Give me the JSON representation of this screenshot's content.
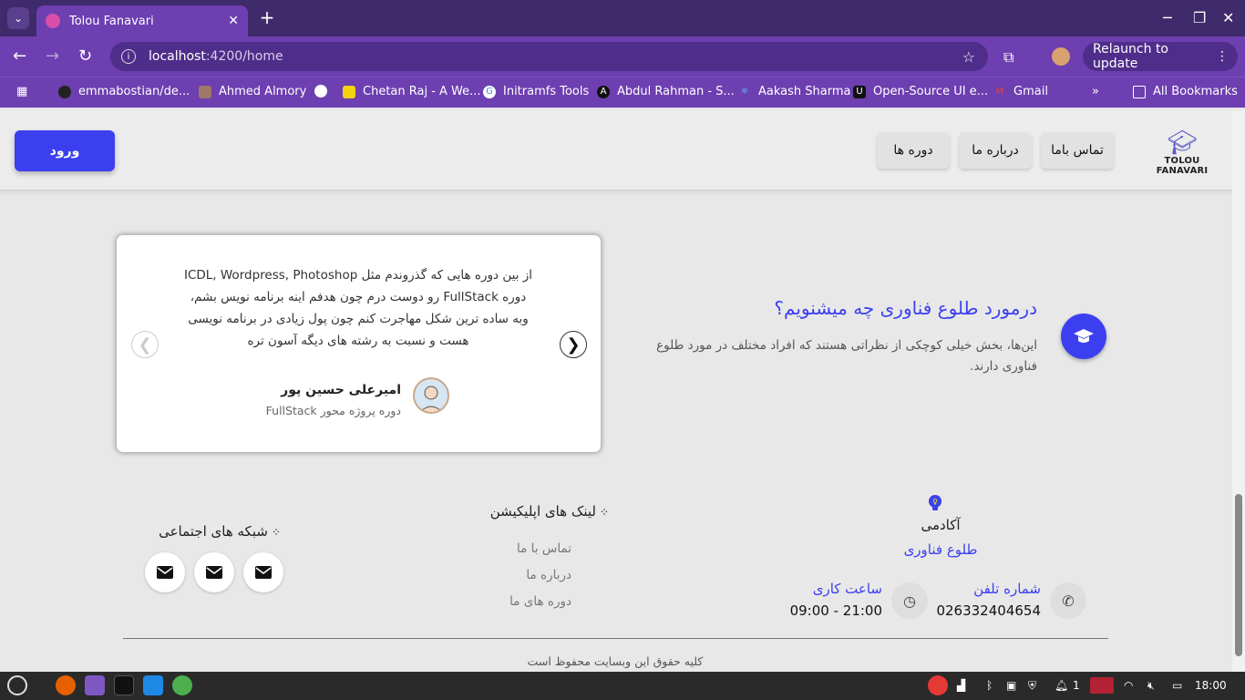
{
  "browser": {
    "tab_title": "Tolou Fanavari",
    "url_host": "localhost",
    "url_path": ":4200/home",
    "relaunch_label": "Relaunch to update",
    "bookmarks": [
      "emmabostian/de...",
      "Ahmed Almory",
      "",
      "Chetan Raj - A We...",
      "Initramfs Tools",
      "Abdul Rahman - S...",
      "Aakash Sharma",
      "Open-Source UI e...",
      "Gmail"
    ],
    "all_bookmarks": "All Bookmarks"
  },
  "header": {
    "login_label": "ورود",
    "nav": [
      "تماس باما",
      "درباره ما",
      "دوره ها"
    ],
    "logo_text": "TOLOU FANAVARI"
  },
  "testimonial": {
    "quote": "از بین دوره هایی که گذروندم مثل ICDL, Wordpress, Photoshop دوره FullStack رو دوست درم چون هدفم اینه برنامه نویس بشم، وبه ساده ترین شکل مهاجرت کنم چون پول زیادی در برنامه نویسی هست و نسبت به رشته های دیگه آسون تره",
    "name": "امیرعلی حسین پور",
    "course": "دوره پروژه محور FullStack",
    "next_arrow": "❯",
    "prev_arrow": "❮"
  },
  "about": {
    "title": "درمورد طلوع فناوری چه میشنویم؟",
    "text": "این‌ها، بخش خیلی کوچکی از نظراتی هستند که افراد مختلف در مورد طلوع فناوری دارند."
  },
  "footer": {
    "social_title": "شبکه های اجتماعی",
    "links_title": "لینک های اپلیکیشن",
    "links": [
      "تماس با ما",
      "درباره ما",
      "دوره های ما"
    ],
    "academy": "آکادمی",
    "academy_name": "طلوع فناوری",
    "phone_label": "شماره تلفن",
    "phone_value": "026332404654",
    "hours_label": "ساعت کاری",
    "hours_value": "09:00 - 21:00",
    "copyright": "کلیه حقوق این وبسایت محفوظ است"
  },
  "taskbar": {
    "clock": "18:00",
    "notif_count": "1"
  },
  "colors": {
    "accent": "#3b3ff0",
    "browser_frame": "#6d3fb0"
  }
}
